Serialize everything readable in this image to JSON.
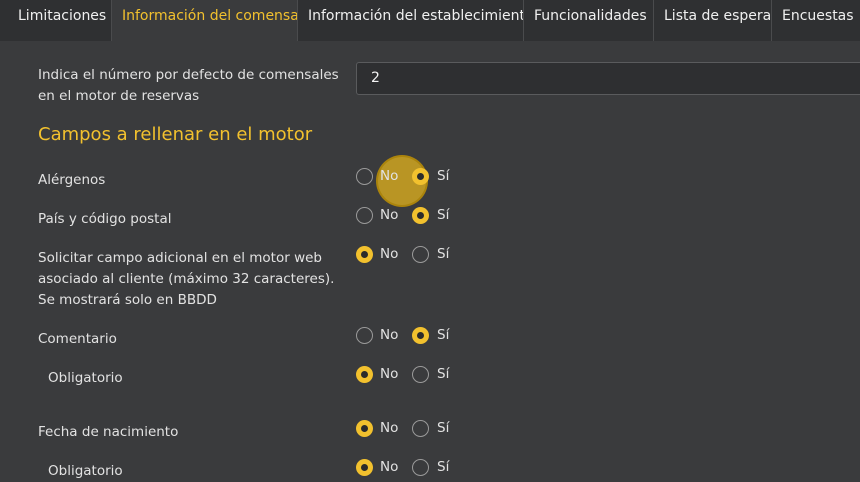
{
  "tabs": [
    {
      "label": "Limitaciones",
      "active": false
    },
    {
      "label": "Información del comensal",
      "active": true
    },
    {
      "label": "Información del establecimiento",
      "active": false
    },
    {
      "label": "Funcionalidades",
      "active": false
    },
    {
      "label": "Lista de espera",
      "active": false
    },
    {
      "label": "Encuestas",
      "active": false
    }
  ],
  "default_diners": {
    "label": "Indica el número por defecto de comensales en el motor de reservas",
    "value": "2"
  },
  "section_title": "Campos a rellenar en el motor",
  "radio_labels": {
    "no": "No",
    "yes": "Sí"
  },
  "fields": [
    {
      "label": "Alérgenos",
      "selected": "yes"
    },
    {
      "label": "País y código postal",
      "selected": "yes"
    },
    {
      "label": "Solicitar campo adicional en el motor web asociado al cliente (máximo 32 caracteres). Se mostrará solo en BBDD",
      "selected": "no"
    },
    {
      "label": "Comentario",
      "selected": "yes"
    },
    {
      "label": "Obligatorio",
      "selected": "no"
    },
    {
      "label": "Fecha de nacimiento",
      "selected": "no"
    },
    {
      "label": "Obligatorio",
      "selected": "no"
    }
  ],
  "colors": {
    "accent": "#f2c12e",
    "background": "#3a3b3d",
    "tabbar": "#2f3032"
  }
}
